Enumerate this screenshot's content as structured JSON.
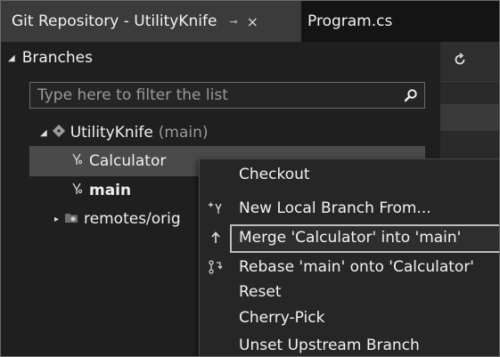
{
  "tabs": {
    "active_title": "Git Repository - UtilityKnife",
    "pin_glyph": "⊸",
    "close_glyph": "×",
    "inactive_title": "Program.cs"
  },
  "panel": {
    "section_title": "Branches",
    "filter_placeholder": "Type here to filter the list",
    "repo": {
      "name": "UtilityKnife",
      "current_branch": "(main)"
    },
    "branches": [
      {
        "label": "Calculator",
        "selected": true
      },
      {
        "label": "main",
        "bold": true
      },
      {
        "label": "remotes/orig"
      }
    ]
  },
  "context_menu": {
    "items": [
      {
        "label": "Checkout",
        "icon": "none"
      },
      {
        "label": "New Local Branch From...",
        "icon": "new-branch-icon"
      },
      {
        "label": "Merge 'Calculator' into 'main'",
        "icon": "merge-icon",
        "highlighted": true
      },
      {
        "label": "Rebase 'main' onto 'Calculator'",
        "icon": "rebase-icon"
      },
      {
        "label": "Reset",
        "icon": "none"
      },
      {
        "label": "Cherry-Pick",
        "icon": "none"
      },
      {
        "label": "Unset Upstream Branch",
        "icon": "none"
      }
    ]
  },
  "colors": {
    "background": "#1f1f1f",
    "active_tab": "#3b3b3b",
    "selection": "#4a4a4a",
    "menu_bg": "#262626",
    "highlight_border": "#bdbdbd",
    "muted_text": "#9a9a9a"
  }
}
